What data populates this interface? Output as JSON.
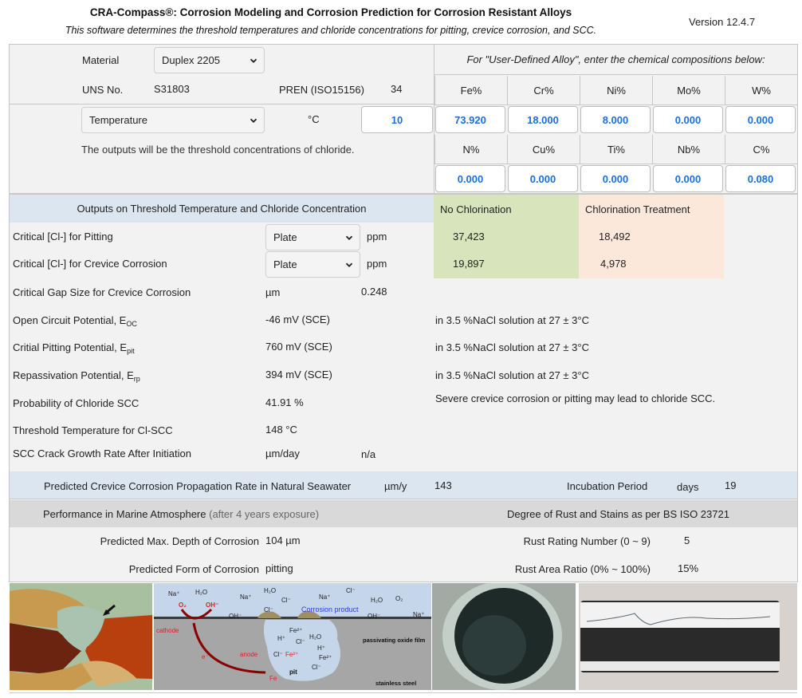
{
  "header": {
    "title": "CRA-Compass®: Corrosion Modeling and Corrosion Prediction for Corrosion Resistant Alloys",
    "subtitle": "This software determines the threshold temperatures and chloride concentrations for pitting, crevice corrosion, and SCC.",
    "version": "Version 12.4.7"
  },
  "inputs": {
    "material_label": "Material",
    "material_value": "Duplex 2205",
    "uns_label": "UNS No.",
    "uns_value": "S31803",
    "pren_label": "PREN (ISO15156)",
    "pren_value": "34",
    "mode_value": "Temperature",
    "mode_unit": "°C",
    "mode_input_value": "10",
    "mode_note": "The outputs will be the threshold concentrations of chloride."
  },
  "composition": {
    "header": "For \"User-Defined Alloy\", enter the chemical compositions below:",
    "row1": [
      {
        "label": "Fe%",
        "value": "73.920"
      },
      {
        "label": "Cr%",
        "value": "18.000"
      },
      {
        "label": "Ni%",
        "value": "8.000"
      },
      {
        "label": "Mo%",
        "value": "0.000"
      },
      {
        "label": "W%",
        "value": "0.000"
      }
    ],
    "row2": [
      {
        "label": "N%",
        "value": "0.000"
      },
      {
        "label": "Cu%",
        "value": "0.000"
      },
      {
        "label": "Ti%",
        "value": "0.000"
      },
      {
        "label": "Nb%",
        "value": "0.000"
      },
      {
        "label": "C%",
        "value": "0.080"
      }
    ]
  },
  "outputs": {
    "header": "Outputs on Threshold Temperature and Chloride Concentration",
    "no_chlorination_label": "No Chlorination",
    "chlorination_label": "Chlorination Treatment",
    "pitting": {
      "label": "Critical [Cl-] for Pitting",
      "geometry": "Plate",
      "unit": "ppm",
      "no_chlor": "37,423",
      "chlor": "18,492"
    },
    "crevice": {
      "label": "Critical [Cl-] for Crevice Corrosion",
      "geometry": "Plate",
      "unit": "ppm",
      "no_chlor": "19,897",
      "chlor": "4,978"
    },
    "gap": {
      "label": "Critical Gap Size for Crevice Corrosion",
      "unit": "µm",
      "value": "0.248"
    },
    "eoc": {
      "label": "Open Circuit Potential, E",
      "sub": "OC",
      "value": "-46 mV (SCE)",
      "note": "in 3.5 %NaCl solution at 27 ± 3°C"
    },
    "epit": {
      "label": "Critial Pitting Potential, E",
      "sub": "pit",
      "value": "760 mV (SCE)",
      "note": "in 3.5 %NaCl solution at 27 ± 3°C"
    },
    "erp": {
      "label": "Repassivation Potential, E",
      "sub": "rp",
      "value": "394 mV (SCE)",
      "note": "in 3.5 %NaCl solution at 27 ± 3°C"
    },
    "scc_prob": {
      "label": "Probability of Chloride SCC",
      "value": "41.91 %",
      "note": "Severe crevice corrosion or pitting may lead to chloride SCC."
    },
    "scc_temp": {
      "label": "Threshold Temperature for Cl-SCC",
      "value": "148 °C"
    },
    "scc_growth": {
      "label": "SCC Crack Growth Rate After Initiation",
      "unit": "µm/day",
      "value": "n/a"
    }
  },
  "seawater": {
    "label": "Predicted Crevice Corrosion Propagation Rate in Natural Seawater",
    "unit": "µm/y",
    "value": "143",
    "incubation_label": "Incubation Period",
    "incubation_unit": "days",
    "incubation_value": "19"
  },
  "marine": {
    "header": "Performance in Marine Atmosphere",
    "header_note": "(after 4 years exposure)",
    "rust_header": "Degree of Rust and Stains as per BS ISO 23721",
    "depth_label": "Predicted Max. Depth of Corrosion",
    "depth_value": "104 µm",
    "form_label": "Predicted Form of Corrosion",
    "form_value": "pitting",
    "rust_rating_label": "Rust Rating Number (0 ~ 9)",
    "rust_rating_value": "5",
    "rust_area_label": "Rust Area Ratio (0% ~ 100%)",
    "rust_area_value": "15%"
  },
  "diagram": {
    "labels": [
      "Na⁺",
      "H₂O",
      "Na⁺",
      "H₂O",
      "Cl⁻",
      "Cl⁻",
      "Na⁺",
      "Cl⁻",
      "H₂O",
      "O₂",
      "Na⁺",
      "OH⁻",
      "Cl⁻",
      "OH⁻"
    ],
    "o2": "O₂",
    "oh": "OH⁻",
    "corrosion_product": "Corrosion product",
    "cathode": "cathode",
    "anode": "anode",
    "electron": "e⁻",
    "fe2": "Fe²⁺",
    "fe": "Fe",
    "pit": "pit",
    "pit_ions": [
      "H⁺",
      "Cl⁻",
      "H₂O",
      "H⁺",
      "Fe²⁺",
      "Cl⁻",
      "Cl⁻"
    ],
    "film": "passivating oxide film",
    "steel": "stainless steel"
  },
  "colors": {
    "accent_blue": "#1a6fe0",
    "no_chlorination_bg": "#d8e4bc",
    "chlorination_bg": "#fce8db",
    "section_blue": "#dce6f0",
    "section_gray": "#d9d9d9"
  }
}
